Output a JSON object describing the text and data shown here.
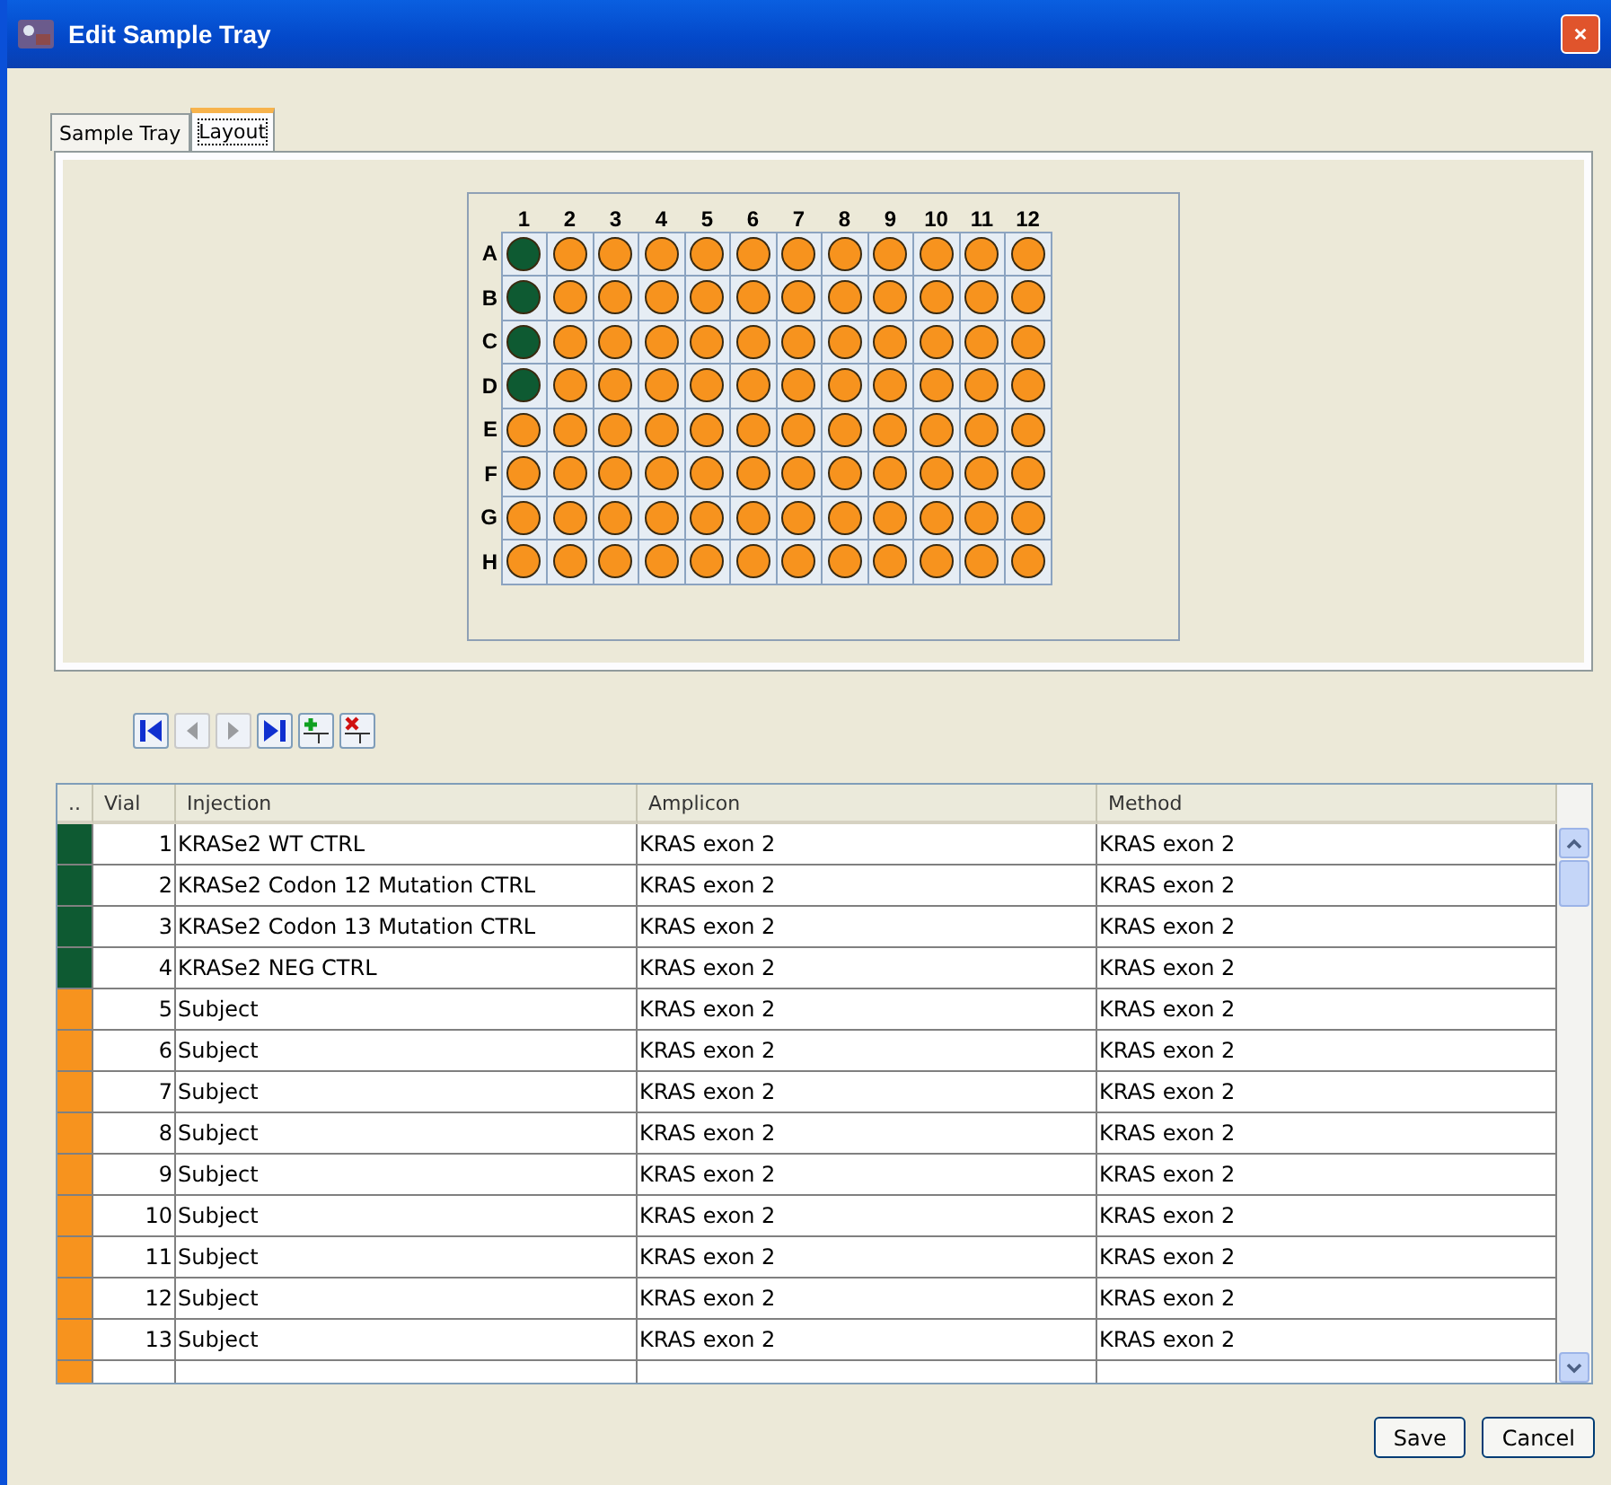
{
  "window": {
    "title": "Edit Sample Tray"
  },
  "tabs": [
    {
      "label": "Sample Tray",
      "selected": false
    },
    {
      "label": "Layout",
      "selected": true
    }
  ],
  "plate": {
    "columns": [
      "1",
      "2",
      "3",
      "4",
      "5",
      "6",
      "7",
      "8",
      "9",
      "10",
      "11",
      "12"
    ],
    "rows": [
      {
        "label": "A",
        "wells": [
          {
            "color": "#0e5a32"
          },
          {
            "color": "#f7931e"
          },
          {
            "color": "#f7931e"
          },
          {
            "color": "#f7931e"
          },
          {
            "color": "#f7931e"
          },
          {
            "color": "#f7931e"
          },
          {
            "color": "#f7931e"
          },
          {
            "color": "#f7931e"
          },
          {
            "color": "#f7931e"
          },
          {
            "color": "#f7931e"
          },
          {
            "color": "#f7931e"
          },
          {
            "color": "#f7931e"
          }
        ]
      },
      {
        "label": "B",
        "wells": [
          {
            "color": "#0e5a32"
          },
          {
            "color": "#f7931e"
          },
          {
            "color": "#f7931e"
          },
          {
            "color": "#f7931e"
          },
          {
            "color": "#f7931e"
          },
          {
            "color": "#f7931e"
          },
          {
            "color": "#f7931e"
          },
          {
            "color": "#f7931e"
          },
          {
            "color": "#f7931e"
          },
          {
            "color": "#f7931e"
          },
          {
            "color": "#f7931e"
          },
          {
            "color": "#f7931e"
          }
        ]
      },
      {
        "label": "C",
        "wells": [
          {
            "color": "#0e5a32"
          },
          {
            "color": "#f7931e"
          },
          {
            "color": "#f7931e"
          },
          {
            "color": "#f7931e"
          },
          {
            "color": "#f7931e"
          },
          {
            "color": "#f7931e"
          },
          {
            "color": "#f7931e"
          },
          {
            "color": "#f7931e"
          },
          {
            "color": "#f7931e"
          },
          {
            "color": "#f7931e"
          },
          {
            "color": "#f7931e"
          },
          {
            "color": "#f7931e"
          }
        ]
      },
      {
        "label": "D",
        "wells": [
          {
            "color": "#0e5a32"
          },
          {
            "color": "#f7931e"
          },
          {
            "color": "#f7931e"
          },
          {
            "color": "#f7931e"
          },
          {
            "color": "#f7931e"
          },
          {
            "color": "#f7931e"
          },
          {
            "color": "#f7931e"
          },
          {
            "color": "#f7931e"
          },
          {
            "color": "#f7931e"
          },
          {
            "color": "#f7931e"
          },
          {
            "color": "#f7931e"
          },
          {
            "color": "#f7931e"
          }
        ]
      },
      {
        "label": "E",
        "wells": [
          {
            "color": "#f7931e"
          },
          {
            "color": "#f7931e"
          },
          {
            "color": "#f7931e"
          },
          {
            "color": "#f7931e"
          },
          {
            "color": "#f7931e"
          },
          {
            "color": "#f7931e"
          },
          {
            "color": "#f7931e"
          },
          {
            "color": "#f7931e"
          },
          {
            "color": "#f7931e"
          },
          {
            "color": "#f7931e"
          },
          {
            "color": "#f7931e"
          },
          {
            "color": "#f7931e"
          }
        ]
      },
      {
        "label": "F",
        "wells": [
          {
            "color": "#f7931e"
          },
          {
            "color": "#f7931e"
          },
          {
            "color": "#f7931e"
          },
          {
            "color": "#f7931e"
          },
          {
            "color": "#f7931e"
          },
          {
            "color": "#f7931e"
          },
          {
            "color": "#f7931e"
          },
          {
            "color": "#f7931e"
          },
          {
            "color": "#f7931e"
          },
          {
            "color": "#f7931e"
          },
          {
            "color": "#f7931e"
          },
          {
            "color": "#f7931e"
          }
        ]
      },
      {
        "label": "G",
        "wells": [
          {
            "color": "#f7931e"
          },
          {
            "color": "#f7931e"
          },
          {
            "color": "#f7931e"
          },
          {
            "color": "#f7931e"
          },
          {
            "color": "#f7931e"
          },
          {
            "color": "#f7931e"
          },
          {
            "color": "#f7931e"
          },
          {
            "color": "#f7931e"
          },
          {
            "color": "#f7931e"
          },
          {
            "color": "#f7931e"
          },
          {
            "color": "#f7931e"
          },
          {
            "color": "#f7931e"
          }
        ]
      },
      {
        "label": "H",
        "wells": [
          {
            "color": "#f7931e"
          },
          {
            "color": "#f7931e"
          },
          {
            "color": "#f7931e"
          },
          {
            "color": "#f7931e"
          },
          {
            "color": "#f7931e"
          },
          {
            "color": "#f7931e"
          },
          {
            "color": "#f7931e"
          },
          {
            "color": "#f7931e"
          },
          {
            "color": "#f7931e"
          },
          {
            "color": "#f7931e"
          },
          {
            "color": "#f7931e"
          },
          {
            "color": "#f7931e"
          }
        ]
      }
    ]
  },
  "toolbar": [
    {
      "kind": "first",
      "disabled": false
    },
    {
      "kind": "previous",
      "disabled": true
    },
    {
      "kind": "next",
      "disabled": true
    },
    {
      "kind": "last",
      "disabled": false
    },
    {
      "kind": "add",
      "disabled": false
    },
    {
      "kind": "delete",
      "disabled": false
    }
  ],
  "table": {
    "columns": [
      "..",
      "Vial",
      "Injection",
      "Amplicon",
      "Method"
    ],
    "rows": [
      {
        "color": "#0e5a32",
        "vial": "1",
        "injection": "KRASe2 WT CTRL",
        "amplicon": "KRAS exon 2",
        "method": "KRAS exon 2"
      },
      {
        "color": "#0e5a32",
        "vial": "2",
        "injection": "KRASe2 Codon 12 Mutation CTRL",
        "amplicon": "KRAS exon 2",
        "method": "KRAS exon 2"
      },
      {
        "color": "#0e5a32",
        "vial": "3",
        "injection": "KRASe2 Codon 13 Mutation CTRL",
        "amplicon": "KRAS exon 2",
        "method": "KRAS exon 2"
      },
      {
        "color": "#0e5a32",
        "vial": "4",
        "injection": "KRASe2 NEG CTRL",
        "amplicon": "KRAS exon 2",
        "method": "KRAS exon 2"
      },
      {
        "color": "#f7931e",
        "vial": "5",
        "injection": "Subject",
        "amplicon": "KRAS exon 2",
        "method": "KRAS exon 2"
      },
      {
        "color": "#f7931e",
        "vial": "6",
        "injection": "Subject",
        "amplicon": "KRAS exon 2",
        "method": "KRAS exon 2"
      },
      {
        "color": "#f7931e",
        "vial": "7",
        "injection": "Subject",
        "amplicon": "KRAS exon 2",
        "method": "KRAS exon 2"
      },
      {
        "color": "#f7931e",
        "vial": "8",
        "injection": "Subject",
        "amplicon": "KRAS exon 2",
        "method": "KRAS exon 2"
      },
      {
        "color": "#f7931e",
        "vial": "9",
        "injection": "Subject",
        "amplicon": "KRAS exon 2",
        "method": "KRAS exon 2"
      },
      {
        "color": "#f7931e",
        "vial": "10",
        "injection": "Subject",
        "amplicon": "KRAS exon 2",
        "method": "KRAS exon 2"
      },
      {
        "color": "#f7931e",
        "vial": "11",
        "injection": "Subject",
        "amplicon": "KRAS exon 2",
        "method": "KRAS exon 2"
      },
      {
        "color": "#f7931e",
        "vial": "12",
        "injection": "Subject",
        "amplicon": "KRAS exon 2",
        "method": "KRAS exon 2"
      },
      {
        "color": "#f7931e",
        "vial": "13",
        "injection": "Subject",
        "amplicon": "KRAS exon 2",
        "method": "KRAS exon 2"
      },
      {
        "color": "#f7931e"
      }
    ]
  },
  "buttons": [
    "Save",
    "Cancel"
  ]
}
